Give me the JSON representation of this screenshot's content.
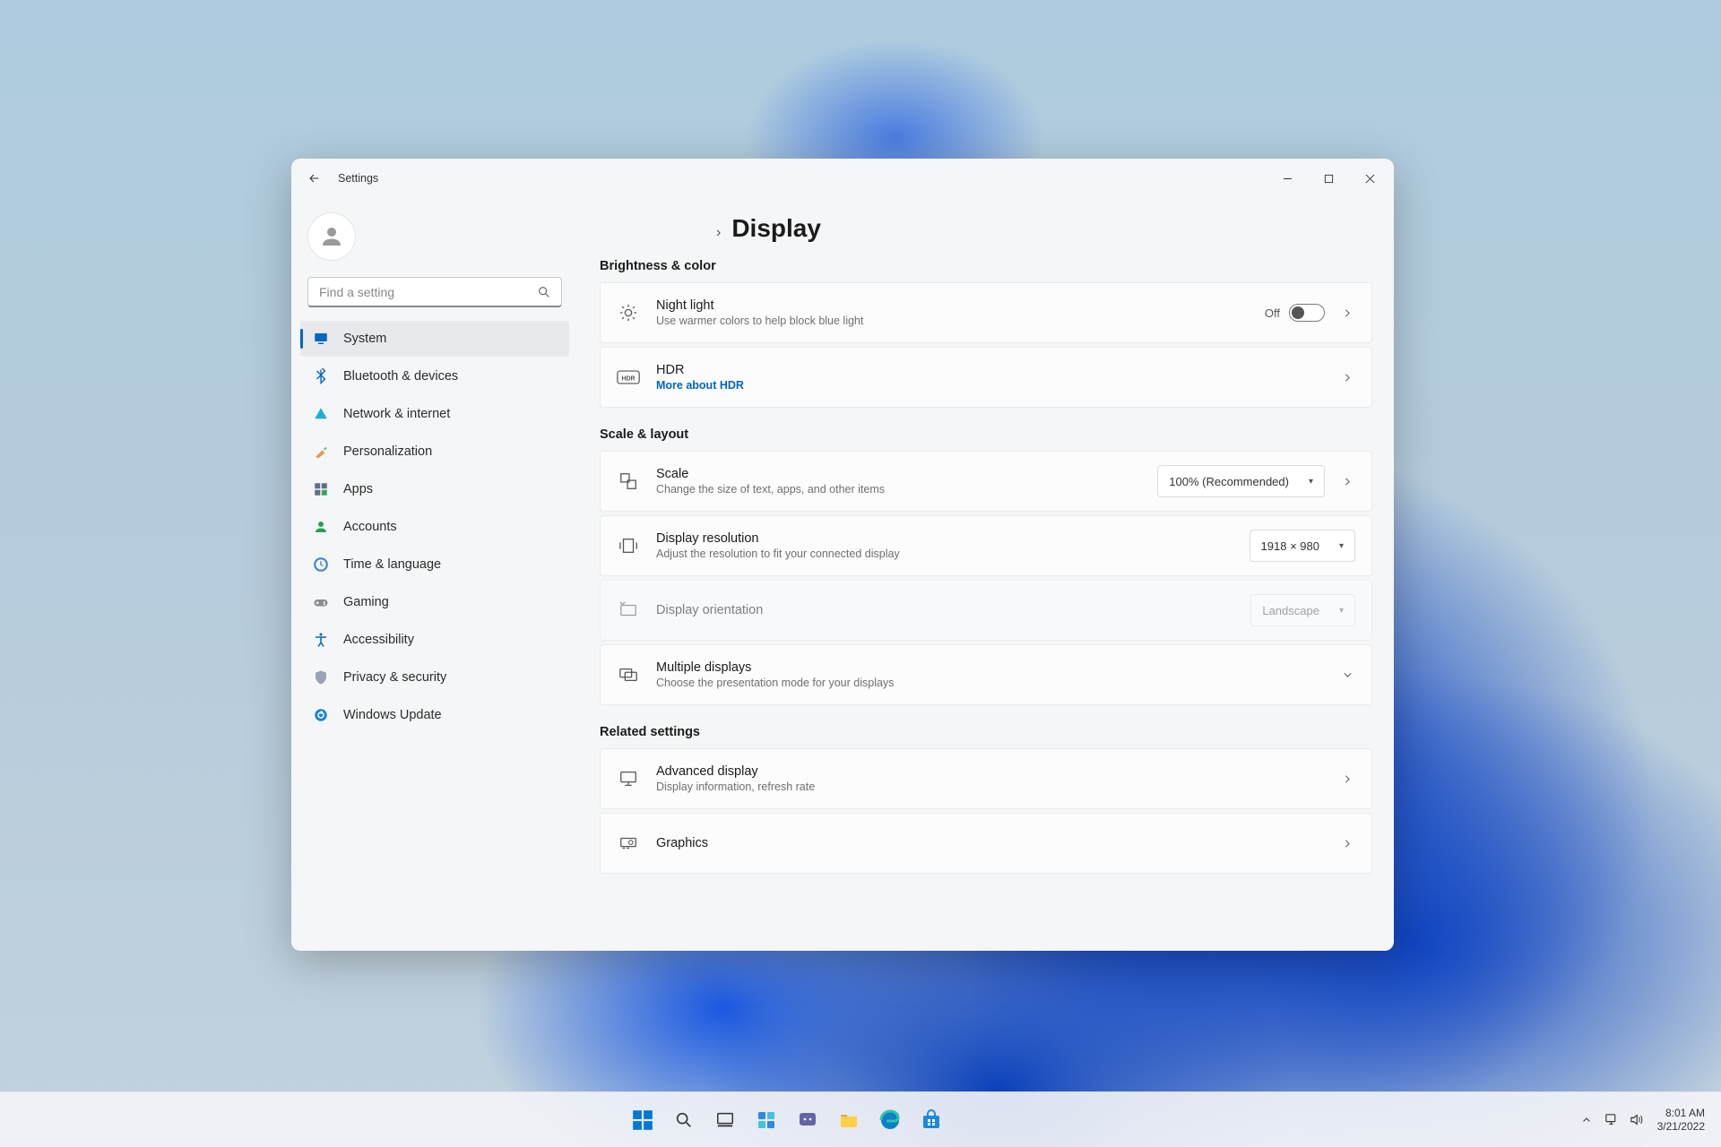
{
  "titlebar": {
    "app_name": "Settings"
  },
  "search": {
    "placeholder": "Find a setting"
  },
  "sidebar": {
    "items": [
      {
        "id": "system",
        "label": "System",
        "active": true
      },
      {
        "id": "bluetooth",
        "label": "Bluetooth & devices",
        "active": false
      },
      {
        "id": "network",
        "label": "Network & internet",
        "active": false
      },
      {
        "id": "personalization",
        "label": "Personalization",
        "active": false
      },
      {
        "id": "apps",
        "label": "Apps",
        "active": false
      },
      {
        "id": "accounts",
        "label": "Accounts",
        "active": false
      },
      {
        "id": "time",
        "label": "Time & language",
        "active": false
      },
      {
        "id": "gaming",
        "label": "Gaming",
        "active": false
      },
      {
        "id": "accessibility",
        "label": "Accessibility",
        "active": false
      },
      {
        "id": "privacy",
        "label": "Privacy & security",
        "active": false
      },
      {
        "id": "update",
        "label": "Windows Update",
        "active": false
      }
    ]
  },
  "breadcrumb": {
    "chevron": "›",
    "page": "Display"
  },
  "sections": {
    "brightness": {
      "title": "Brightness & color",
      "night_light": {
        "title": "Night light",
        "sub": "Use warmer colors to help block blue light",
        "state_label": "Off"
      },
      "hdr": {
        "title": "HDR",
        "link": "More about HDR"
      }
    },
    "scale": {
      "title": "Scale & layout",
      "scale": {
        "title": "Scale",
        "sub": "Change the size of text, apps, and other items",
        "value": "100% (Recommended)"
      },
      "resolution": {
        "title": "Display resolution",
        "sub": "Adjust the resolution to fit your connected display",
        "value": "1918 × 980"
      },
      "orientation": {
        "title": "Display orientation",
        "value": "Landscape"
      },
      "multiple": {
        "title": "Multiple displays",
        "sub": "Choose the presentation mode for your displays"
      }
    },
    "related": {
      "title": "Related settings",
      "advanced": {
        "title": "Advanced display",
        "sub": "Display information, refresh rate"
      },
      "graphics": {
        "title": "Graphics"
      }
    }
  },
  "tray": {
    "time": "8:01 AM",
    "date": "3/21/2022"
  }
}
